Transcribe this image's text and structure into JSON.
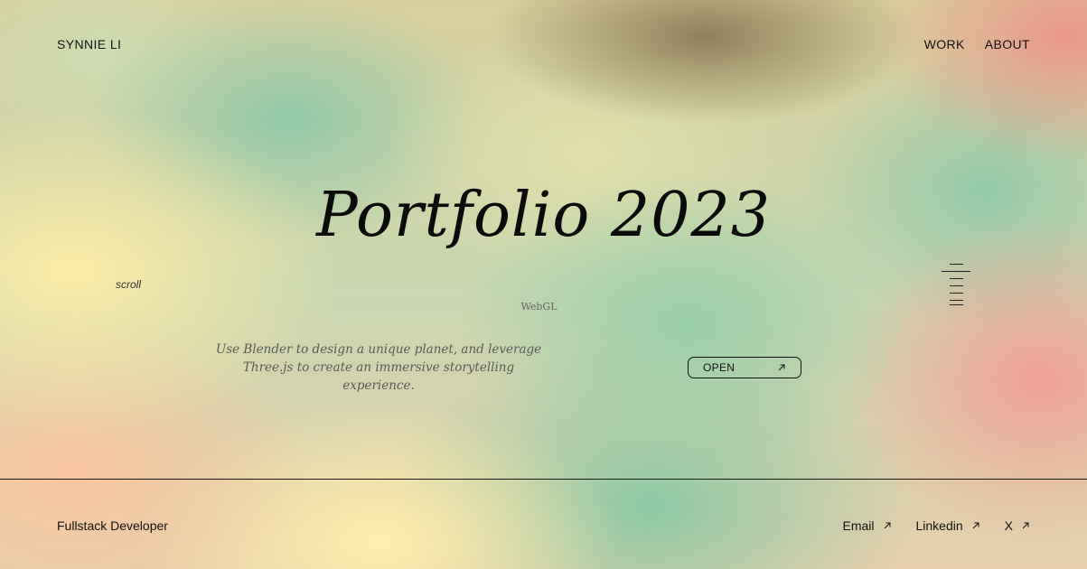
{
  "header": {
    "brand": "SYNNIE LI",
    "nav": [
      {
        "label": "WORK"
      },
      {
        "label": "ABOUT"
      }
    ]
  },
  "hero": {
    "title": "Portfolio 2023",
    "scroll_hint": "scroll",
    "tag": "WebGL",
    "description": "Use Blender to design a unique planet, and leverage Three.js to create an immersive storytelling experience.",
    "open_button": "OPEN",
    "open_icon": "arrow-up-right-icon",
    "index_icon": "project-index-lines-icon"
  },
  "footer": {
    "role": "Fullstack Developer",
    "links": [
      {
        "label": "Email",
        "icon": "arrow-up-right-icon"
      },
      {
        "label": "Linkedin",
        "icon": "arrow-up-right-icon"
      },
      {
        "label": "X",
        "icon": "arrow-up-right-icon"
      }
    ]
  },
  "colors": {
    "text": "#111111",
    "muted_text": "#5a5a5a",
    "gradient_yellow": "#ffeeaa",
    "gradient_green": "#8cc8a5",
    "gradient_pink": "#f0a096",
    "gradient_olive": "#8c7d5a"
  }
}
